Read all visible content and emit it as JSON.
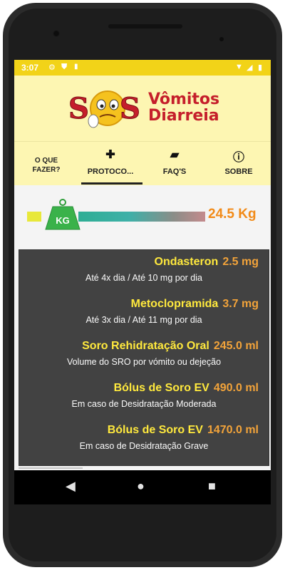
{
  "statusbar": {
    "time": "3:07",
    "icons": [
      "gear-icon",
      "shield-icon",
      "sd-card-icon"
    ],
    "right_icons": [
      "wifi-icon",
      "signal-icon",
      "battery-icon"
    ]
  },
  "header": {
    "logo_letters": "SOS",
    "app_title_line1": "Vômitos",
    "app_title_line2": "Diarreia"
  },
  "tabs": [
    {
      "label": "O QUE FAZER?",
      "icon": null,
      "selected": false
    },
    {
      "label": "PROTOCO...",
      "icon": "bandage-icon",
      "selected": true
    },
    {
      "label": "FAQ'S",
      "icon": "forum-icon",
      "selected": false
    },
    {
      "label": "SOBRE",
      "icon": "info-icon",
      "selected": false
    }
  ],
  "weight": {
    "tag_label": "KG",
    "value_text": "24.5 Kg",
    "slider_fraction": 0.2
  },
  "drugs": [
    {
      "name": "Ondasteron",
      "dose": "2.5 mg",
      "note": "Até 4x dia / Até 10 mg por dia"
    },
    {
      "name": "Metoclopramida",
      "dose": "3.7 mg",
      "note": "Até 3x dia / Até 11 mg por dia"
    },
    {
      "name": "Soro Rehidratação Oral",
      "dose": "245.0 ml",
      "note": "Volume do SRO por vómito ou dejeção"
    },
    {
      "name": "Bólus de Soro EV",
      "dose": "490.0 ml",
      "note": "Em caso de Desidratação Moderada"
    },
    {
      "name": "Bólus de Soro EV",
      "dose": "1470.0 ml",
      "note": "Em caso de Desidratação Grave"
    }
  ],
  "colors": {
    "statusbar": "#f2d318",
    "header_bg": "#fdf6b2",
    "brand_red": "#c51f2b",
    "drug_name": "#ffe93d",
    "dose": "#f2a33a",
    "weight": "#f28a17",
    "panel_bg": "#424242"
  },
  "navigation": [
    "back-icon",
    "home-icon",
    "recents-icon"
  ]
}
